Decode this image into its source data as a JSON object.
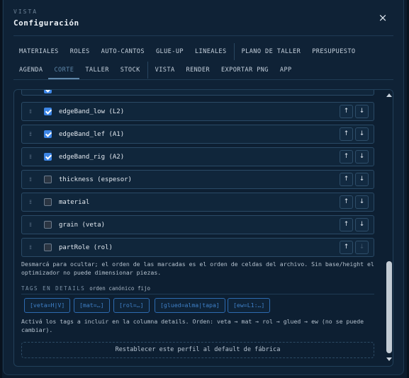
{
  "header": {
    "eyebrow": "VISTA",
    "title": "Configuración",
    "close_icon": "×"
  },
  "tabs": {
    "row1": [
      "MATERIALES",
      "ROLES",
      "AUTO-CANTOS",
      "GLUE-UP",
      "LINEALES",
      "PLANO DE TALLER",
      "PRESUPUESTO"
    ],
    "row2": [
      "AGENDA",
      "CORTE",
      "TALLER",
      "STOCK",
      "VISTA",
      "RENDER",
      "EXPORTAR PNG",
      "APP"
    ],
    "active": "CORTE"
  },
  "columns": [
    {
      "label": "edgeBand_low (L2)",
      "checked": true,
      "up": "↑",
      "down": "↓"
    },
    {
      "label": "edgeBand_lef (A1)",
      "checked": true,
      "up": "↑",
      "down": "↓"
    },
    {
      "label": "edgeBand_rig (A2)",
      "checked": true,
      "up": "↑",
      "down": "↓"
    },
    {
      "label": "thickness (espesor)",
      "checked": false,
      "up": "↑",
      "down": "↓"
    },
    {
      "label": "material",
      "checked": false,
      "up": "↑",
      "down": "↓"
    },
    {
      "label": "grain (veta)",
      "checked": false,
      "up": "↑",
      "down": "↓"
    },
    {
      "label": "partRole (rol)",
      "checked": false,
      "up": "↑",
      "down": "↓"
    }
  ],
  "grip_icon": "⁞⁞",
  "hint": "Desmarcá para ocultar; el orden de las marcadas es el orden de celdas del archivo. Sin base/height el optimizador no puede dimensionar piezas.",
  "tags": {
    "title": "TAGS EN DETAILS",
    "subtitle": "orden canónico fijo",
    "chips": [
      "[veta=H|V]",
      "[mat=…]",
      "[rol=…]",
      "[glued=alma|tapa]",
      "[ew=L1:…]"
    ],
    "hint": "Activá los tags a incluir en la columna details. Orden: veta → mat → rol → glued → ew (no se puede cambiar)."
  },
  "reset_label": "Restablecer este perfil al default de fábrica",
  "colors": {
    "accent": "#3d86e6",
    "chip": "#3f80c8",
    "active_tab": "#5e86a8"
  }
}
